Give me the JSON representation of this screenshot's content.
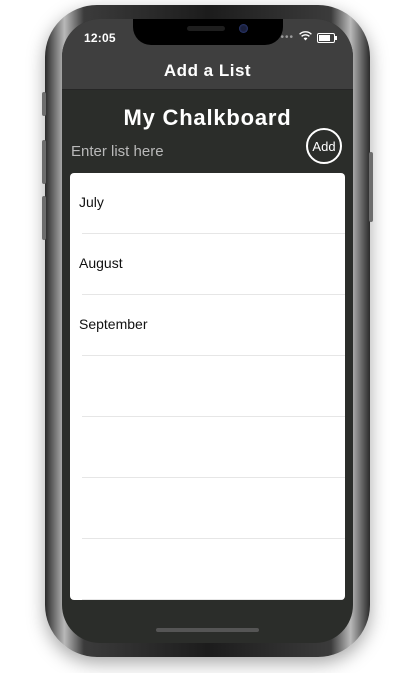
{
  "status_bar": {
    "time": "12:05",
    "battery_level": 0.8
  },
  "nav": {
    "title": "Add a List"
  },
  "board": {
    "title": "My Chalkboard"
  },
  "input": {
    "placeholder": "Enter list here",
    "value": ""
  },
  "add_button": {
    "label": "Add"
  },
  "lists": [
    {
      "label": "July"
    },
    {
      "label": "August"
    },
    {
      "label": "September"
    },
    {
      "label": ""
    },
    {
      "label": ""
    },
    {
      "label": ""
    },
    {
      "label": ""
    }
  ],
  "colors": {
    "chalkboard": "#2b2d2a",
    "nav_bar": "#3f3f3f",
    "list_background": "#ffffff",
    "separator": "#e6e6e6",
    "text_on_dark": "#ffffff"
  },
  "icons": [
    "wifi-icon",
    "battery-icon",
    "signal-icon"
  ]
}
